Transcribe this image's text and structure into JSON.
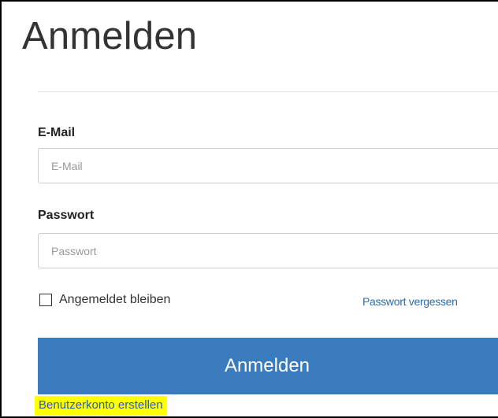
{
  "page": {
    "title": "Anmelden"
  },
  "form": {
    "email": {
      "label": "E-Mail",
      "placeholder": "E-Mail",
      "value": ""
    },
    "password": {
      "label": "Passwort",
      "placeholder": "Passwort",
      "value": ""
    },
    "remember_me": {
      "label": "Angemeldet bleiben",
      "checked": false
    },
    "forgot_password_label": "Passwort vergessen",
    "submit_label": "Anmelden",
    "create_account_label": "Benutzerkonto erstellen"
  },
  "colors": {
    "button_background": "#3a7bbd",
    "link": "#2d6ea8",
    "highlight": "#ffff00"
  }
}
